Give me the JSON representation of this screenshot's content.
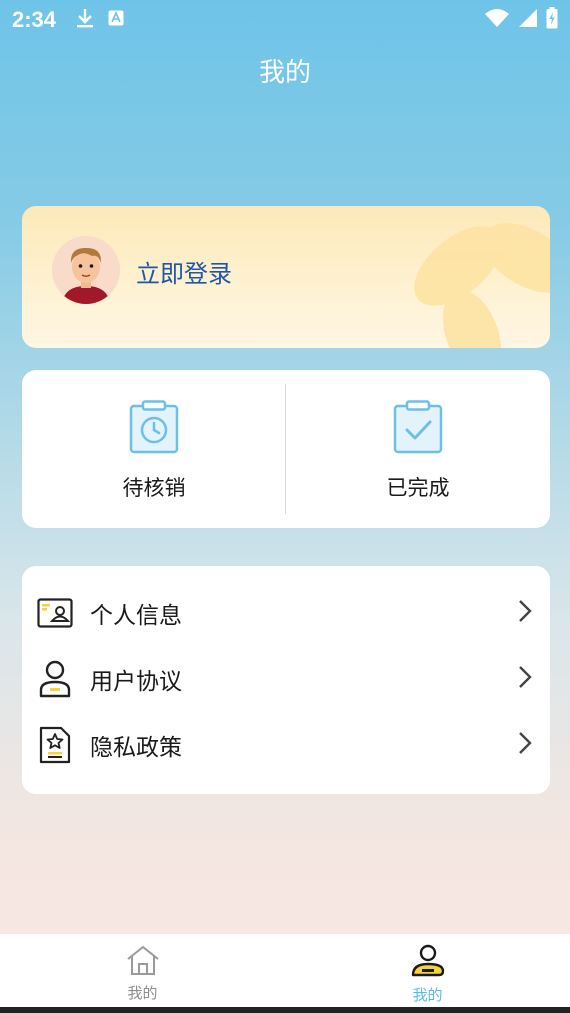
{
  "status": {
    "time": "2:34"
  },
  "header": {
    "title": "我的"
  },
  "login": {
    "label": "立即登录"
  },
  "orders": {
    "items": [
      {
        "label": "待核销",
        "icon": "clipboard-clock-icon"
      },
      {
        "label": "已完成",
        "icon": "clipboard-check-icon"
      }
    ]
  },
  "menu": {
    "items": [
      {
        "label": "个人信息",
        "icon": "id-card-icon"
      },
      {
        "label": "用户协议",
        "icon": "user-icon"
      },
      {
        "label": "隐私政策",
        "icon": "document-star-icon"
      }
    ]
  },
  "bottom_nav": {
    "items": [
      {
        "label": "我的",
        "icon": "home-icon",
        "active": false
      },
      {
        "label": "我的",
        "icon": "profile-icon",
        "active": true
      }
    ]
  },
  "colors": {
    "accent": "#5bbbe6",
    "login_text": "#1f57a8",
    "highlight_yellow": "#f5d33a"
  }
}
